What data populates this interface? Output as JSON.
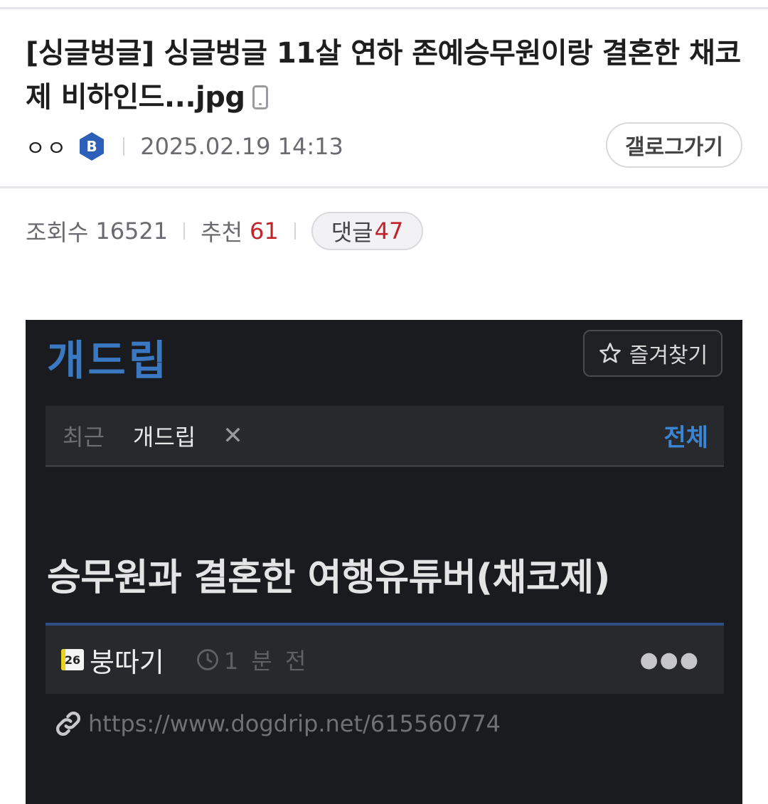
{
  "post": {
    "title": "[싱글벙글] 싱글벙글 11살 연하 존예승무원이랑 결혼한 채코제 비하인드...jpg",
    "author": "ㅇㅇ",
    "badge_letter": "B",
    "date": "2025.02.19 14:13",
    "gallery_button": "갤로그가기"
  },
  "stats": {
    "views_label": "조회수",
    "views": "16521",
    "recommend_label": "추천",
    "recommend": "61",
    "comments_label": "댓글",
    "comments": "47"
  },
  "embedded": {
    "logo": "개드립",
    "favorite_label": "즐겨찾기",
    "recent_label": "최근",
    "recent_item": "개드립",
    "recent_close": "✕",
    "recent_all": "전체",
    "post_title": "승무원과 결혼한 여행유튜버(채코제)",
    "level_badge": "26",
    "nickname": "붕따기",
    "time": "1 분 전",
    "more": "●●●",
    "url": "https://www.dogdrip.net/615560774"
  },
  "colors": {
    "accent_red": "#c0242a",
    "badge_blue": "#2c5fb8",
    "dogdrip_blue": "#3a78c2",
    "dark_bg": "#1a1b1e"
  },
  "icons": [
    "phone-icon",
    "grade-badge-icon",
    "star-icon",
    "close-icon",
    "clock-icon",
    "more-icon",
    "link-icon"
  ]
}
